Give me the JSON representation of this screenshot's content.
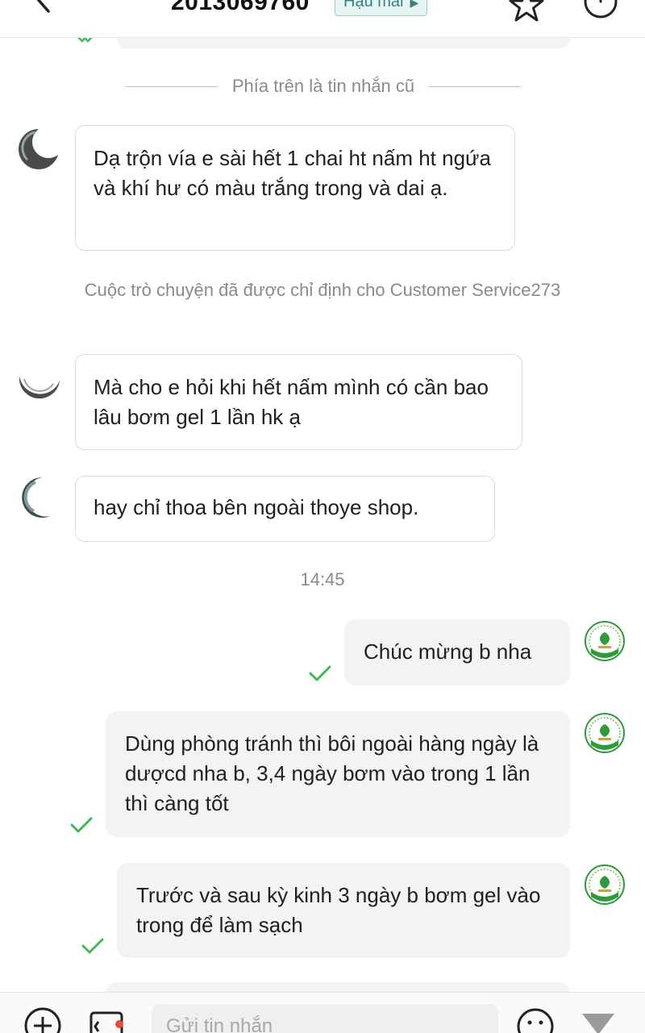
{
  "header": {
    "title": "2013069760",
    "badge": "Hậu mãi",
    "icons": [
      "back-icon",
      "star-icon",
      "more-icon"
    ]
  },
  "divider_text": "Phía trên là tin nhắn cũ",
  "messages_in": [
    {
      "text": "Dạ trộn vía e sài hết 1 chai ht nấm ht ngứa và khí hư có màu trắng trong và dai ạ."
    },
    {
      "text": "Mà cho e hỏi khi hết nấm mình có cần bao lâu bơm gel 1 lần hk ạ"
    },
    {
      "text": "hay chỉ thoa bên ngoài thoye shop."
    }
  ],
  "system_note": "Cuộc trò chuyện đã được chỉ định cho Customer Service273",
  "timestamp": "14:45",
  "messages_out": [
    {
      "text": "Chúc mừng b nha",
      "status": "read"
    },
    {
      "text": "Dùng phòng tránh thì bôi ngoài hàng ngày là dượcd nha b, 3,4 ngày bơm vào trong 1 lần thì càng tốt",
      "status": "read"
    },
    {
      "text": "Trước và sau kỳ kinh 3 ngày b bơm gel vào trong để làm sạch",
      "status": "read"
    }
  ],
  "composer": {
    "placeholder": "Gửi tin nhắn",
    "icons": [
      "plus-icon",
      "image-icon",
      "emoji-icon",
      "send-icon"
    ]
  },
  "colors": {
    "check": "#3fb950",
    "badge_bg": "#e6f4f4",
    "badge_text": "#3c7f80",
    "shop_avatar_green": "#2f9a3a",
    "notification_dot": "#f04a36"
  }
}
